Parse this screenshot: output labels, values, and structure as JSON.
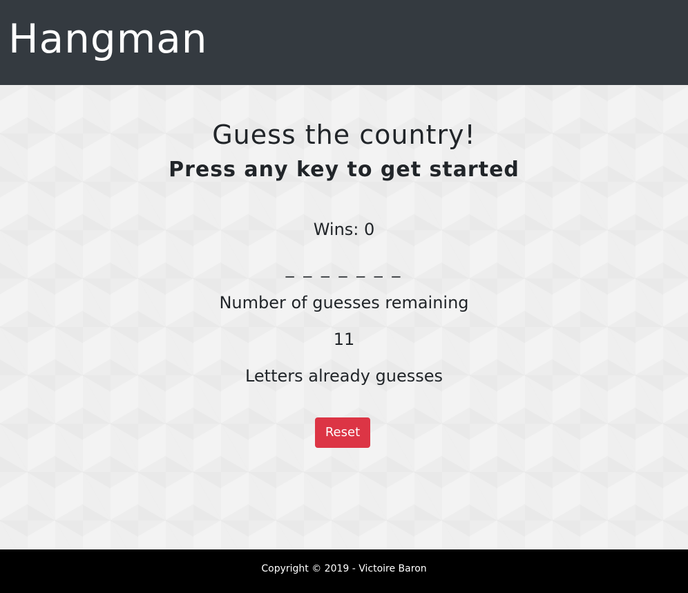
{
  "header": {
    "title": "Hangman"
  },
  "game": {
    "headline": "Guess the country!",
    "subheadline": "Press any key to get started",
    "wins_text": "Wins: 0",
    "word_display": "_ _ _ _ _ _ _",
    "guesses_label": "Number of guesses remaining",
    "guesses_remaining": "11",
    "letters_label": "Letters already guesses",
    "reset_label": "Reset"
  },
  "footer": {
    "copyright": "Copyright © 2019 - Victoire Baron"
  },
  "colors": {
    "header_bg": "#343a40",
    "page_bg": "#f3f3f3",
    "reset_button": "#dc3545",
    "footer_bg": "#000000"
  }
}
